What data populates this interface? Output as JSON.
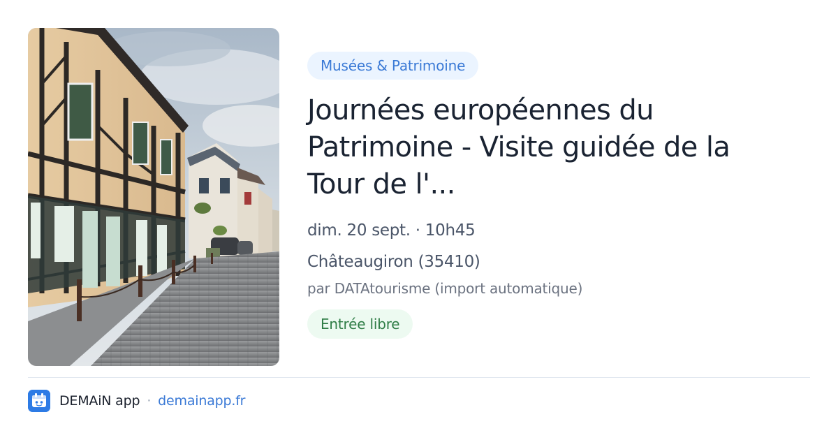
{
  "event": {
    "category": "Musées & Patrimoine",
    "title": "Journées européennes du Patrimoine - Visite guidée de la Tour de l'...",
    "date_time": "dim. 20 sept. · 10h45",
    "location": "Châteaugiron (35410)",
    "source": "par DATAtourisme (import automatique)",
    "price": "Entrée libre"
  },
  "footer": {
    "app_name": "DEMAiN app",
    "separator": "·",
    "url": "demainapp.fr"
  },
  "icons": {
    "app_icon": "demain-app-icon"
  },
  "colors": {
    "accent": "#3b7ad6",
    "category_badge_bg": "#ebf4ff",
    "price_badge_bg": "#edfaf1",
    "price_badge_text": "#2f7d46",
    "app_icon_bg": "#2d7be5"
  }
}
